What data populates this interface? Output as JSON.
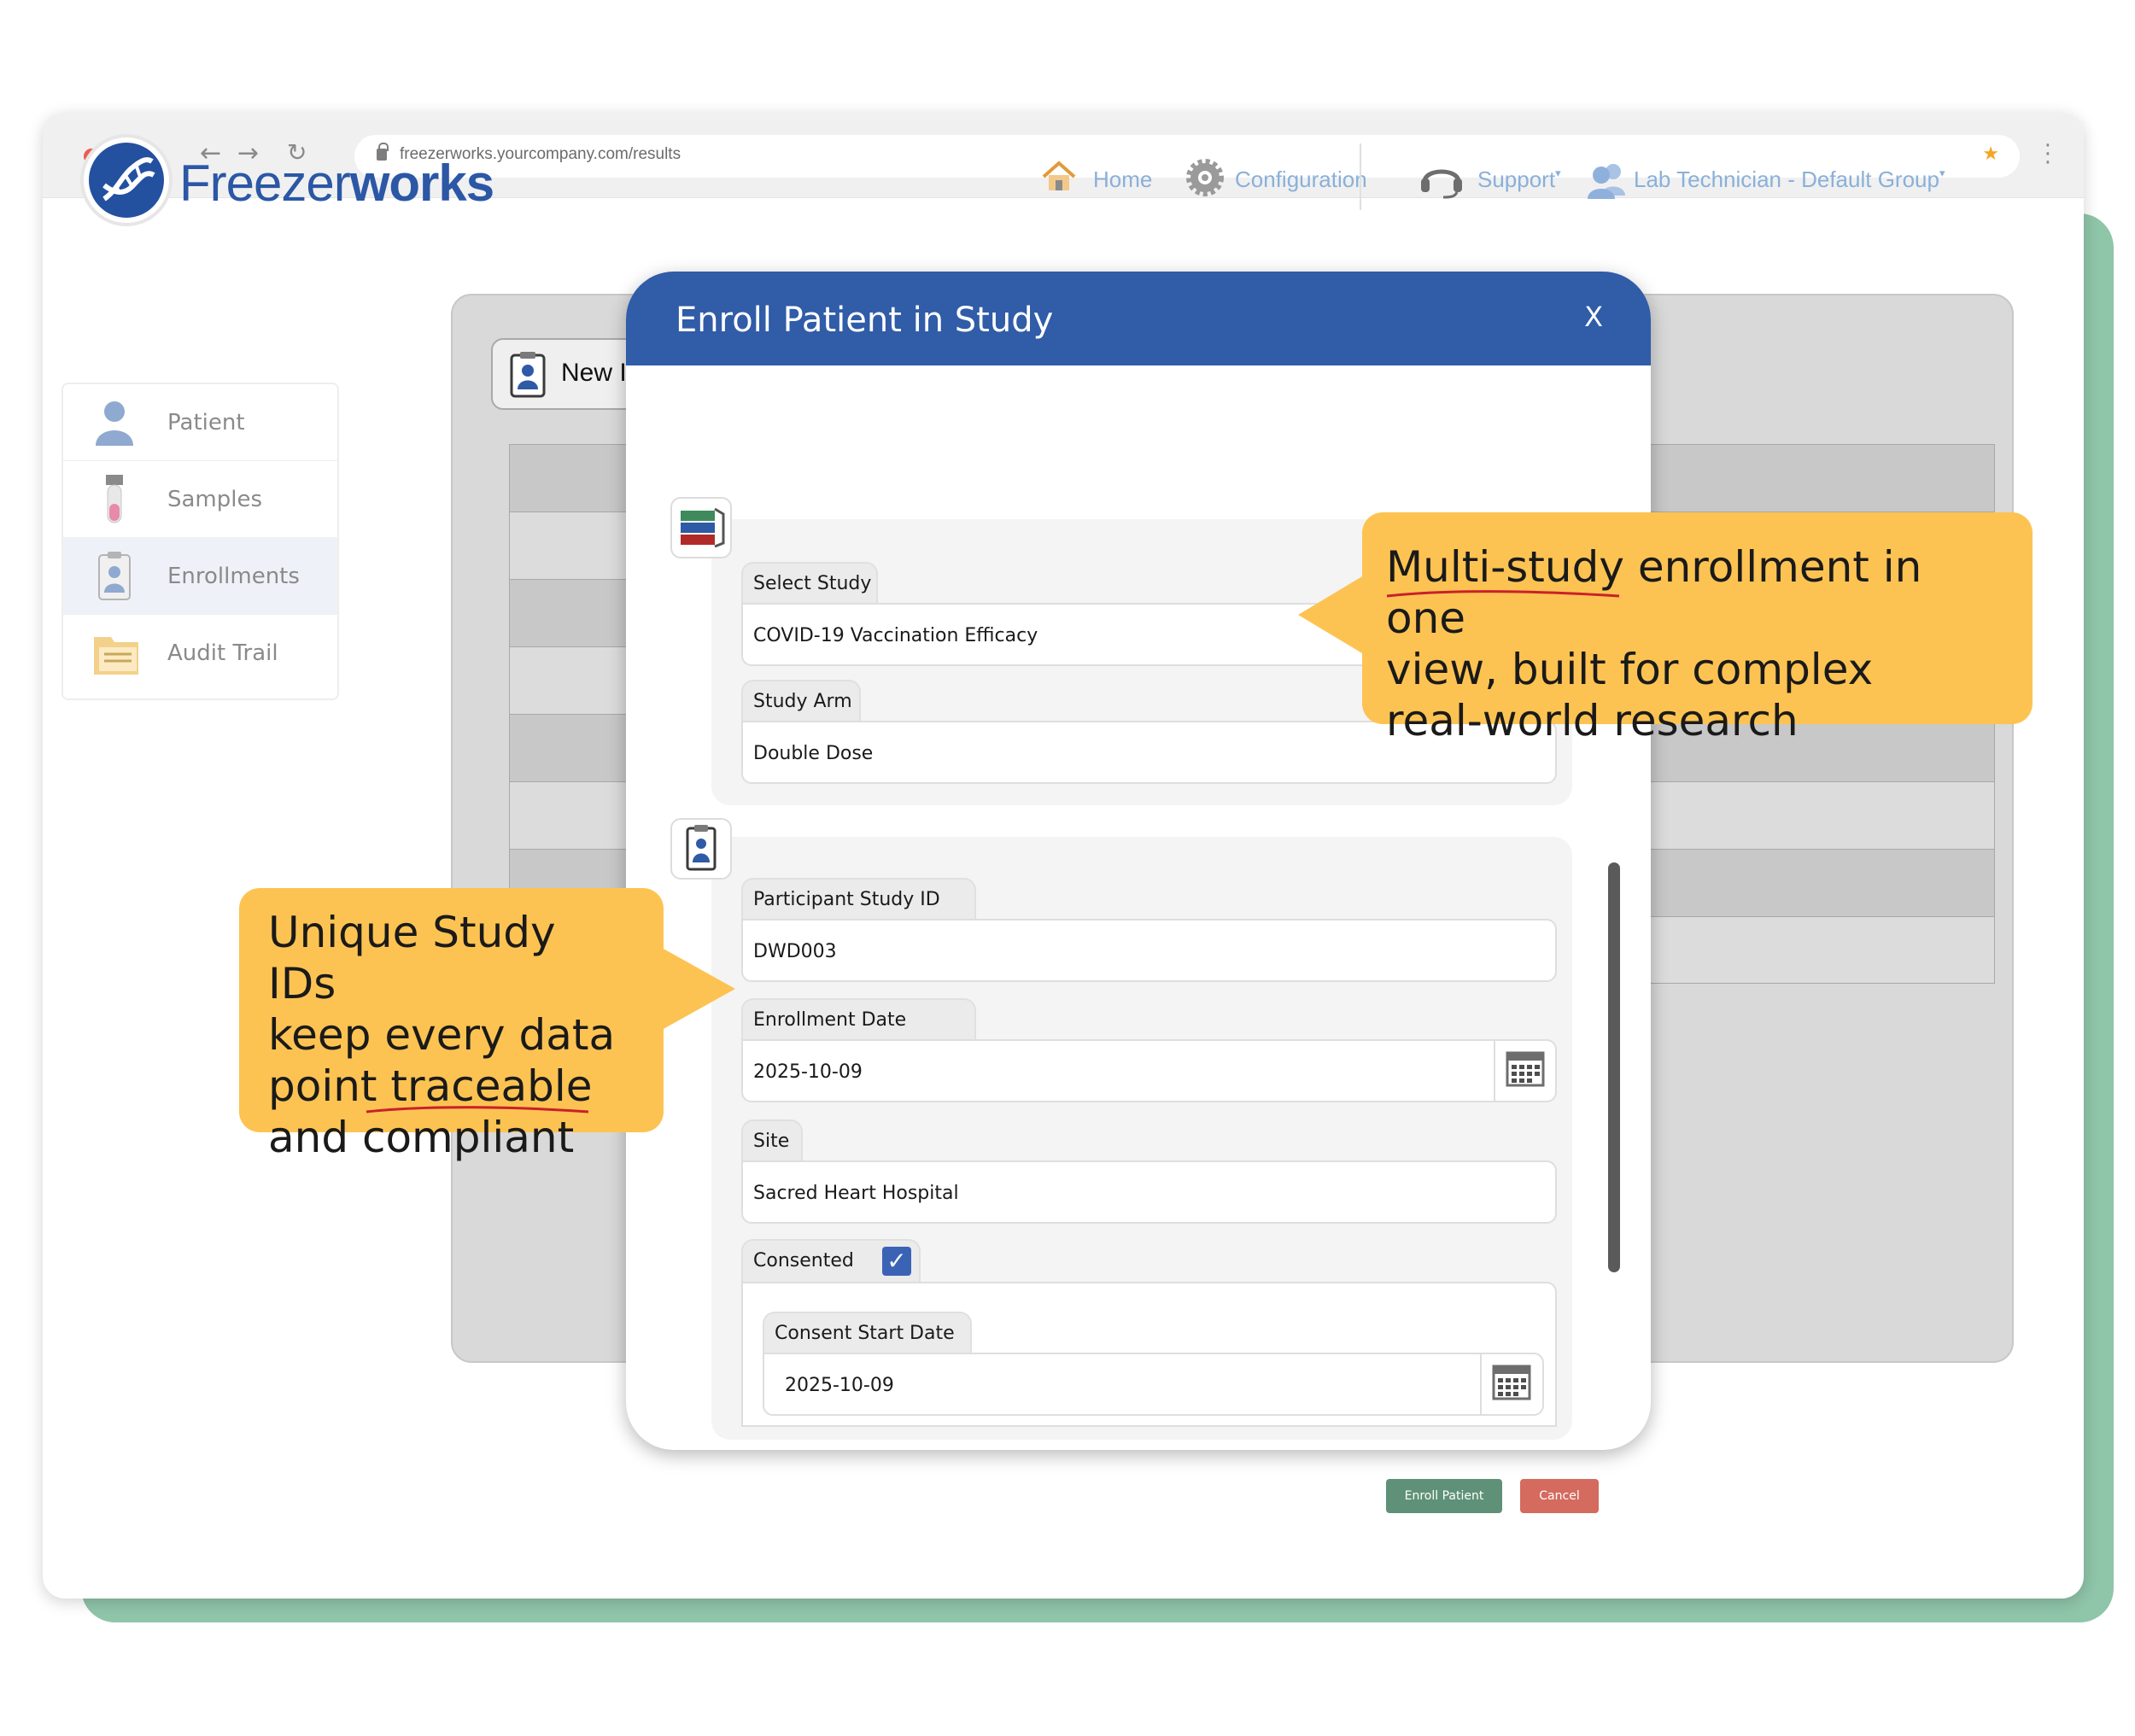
{
  "browser": {
    "url": "freezerworks.yourcompany.com/results",
    "traffic_lights": [
      "#ee5a50",
      "#f6b331",
      "#27c33f"
    ]
  },
  "header": {
    "brand_light": "Freezer",
    "brand_bold": "works",
    "nav": {
      "home": "Home",
      "configuration": "Configuration",
      "support": "Support",
      "user_group": "Lab Technician - Default Group"
    }
  },
  "sidebar": {
    "items": [
      {
        "label": "Patient",
        "icon": "patient-icon"
      },
      {
        "label": "Samples",
        "icon": "sample-tube-icon"
      },
      {
        "label": "Enrollments",
        "icon": "clipboard-icon",
        "active": true
      },
      {
        "label": "Audit Trail",
        "icon": "folder-icon"
      }
    ]
  },
  "background_panel": {
    "new_button": "New I"
  },
  "modal": {
    "title": "Enroll Patient in Study",
    "close": "X",
    "study_section": {
      "select_study_label": "Select Study",
      "select_study_value": "COVID-19 Vaccination Efficacy",
      "study_arm_label": "Study Arm",
      "study_arm_value": "Double Dose"
    },
    "participant_section": {
      "participant_id_label": "Participant Study ID",
      "participant_id_value": "DWD003",
      "enrollment_date_label": "Enrollment Date",
      "enrollment_date_value": "2025-10-09",
      "site_label": "Site",
      "site_value": "Sacred Heart Hospital",
      "consented_label": "Consented",
      "consented_checked": true,
      "consent_start_label": "Consent Start Date",
      "consent_start_value": "2025-10-09"
    },
    "enroll_button": "Enroll Patient",
    "cancel_button": "Cancel"
  },
  "callouts": {
    "right_line1": "Multi-study enrollment in one",
    "right_line2": "view, built for complex",
    "right_line3": "real-world research",
    "left_line1": "Unique Study IDs",
    "left_line2": "keep every data",
    "left_line3": "point traceable",
    "left_line4": "and compliant"
  },
  "colors": {
    "accent_green": "#8fc5a9",
    "modal_header": "#305ca8",
    "callout": "#fdc352",
    "brand_blue": "#2b57a5"
  }
}
